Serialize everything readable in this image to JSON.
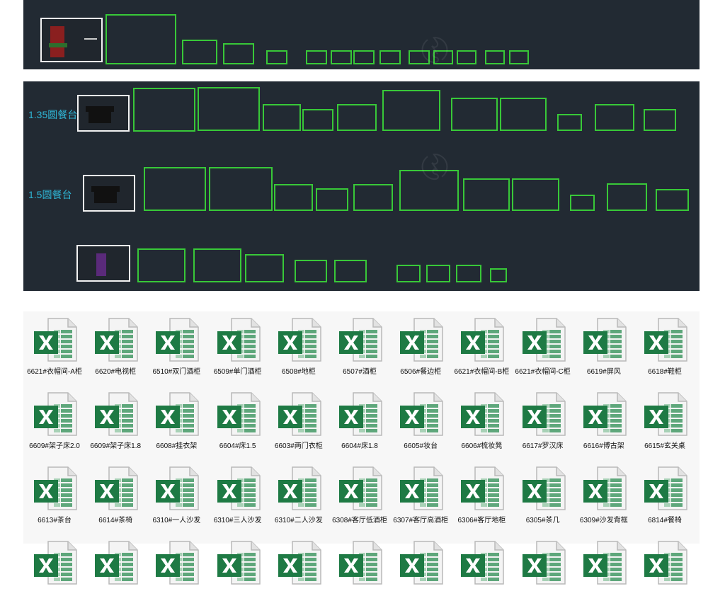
{
  "cad": {
    "accent_green": "#38c838",
    "label_color": "#2fb6d6",
    "labels": {
      "row_135": "1.35圆餐台",
      "row_15": "1.5圆餐台"
    }
  },
  "files": [
    {
      "name": "6621#衣帽间-A柜"
    },
    {
      "name": "6620#电视柜"
    },
    {
      "name": "6510#双门酒柜"
    },
    {
      "name": "6509#单门酒柜"
    },
    {
      "name": "6508#地柜"
    },
    {
      "name": "6507#酒柜"
    },
    {
      "name": "6506#餐边柜"
    },
    {
      "name": "6621#衣帽间-B柜"
    },
    {
      "name": "6621#衣帽间-C柜"
    },
    {
      "name": "6619#屏风"
    },
    {
      "name": "6618#鞋柜"
    },
    {
      "name": "6609#架子床2.0"
    },
    {
      "name": "6609#架子床1.8"
    },
    {
      "name": "6608#挂衣架"
    },
    {
      "name": "6604#床1.5"
    },
    {
      "name": "6603#两门衣柜"
    },
    {
      "name": "6604#床1.8"
    },
    {
      "name": "6605#妆台"
    },
    {
      "name": "6606#梳妆凳"
    },
    {
      "name": "6617#罗汉床"
    },
    {
      "name": "6616#博古架"
    },
    {
      "name": "6615#玄关桌"
    },
    {
      "name": "6613#茶台"
    },
    {
      "name": "6614#茶椅"
    },
    {
      "name": "6310#一人沙发"
    },
    {
      "name": "6310#三人沙发"
    },
    {
      "name": "6310#二人沙发"
    },
    {
      "name": "6308#客厅低酒柜"
    },
    {
      "name": "6307#客厅高酒柜"
    },
    {
      "name": "6306#客厅地柜"
    },
    {
      "name": "6305#茶几"
    },
    {
      "name": "6309#沙发背框"
    },
    {
      "name": "6814#餐椅"
    },
    {
      "name": ""
    },
    {
      "name": ""
    },
    {
      "name": ""
    },
    {
      "name": ""
    },
    {
      "name": ""
    },
    {
      "name": ""
    },
    {
      "name": ""
    },
    {
      "name": ""
    },
    {
      "name": ""
    },
    {
      "name": ""
    },
    {
      "name": ""
    }
  ],
  "icon": {
    "name": "excel-file-icon",
    "green": "#1e7a44"
  }
}
